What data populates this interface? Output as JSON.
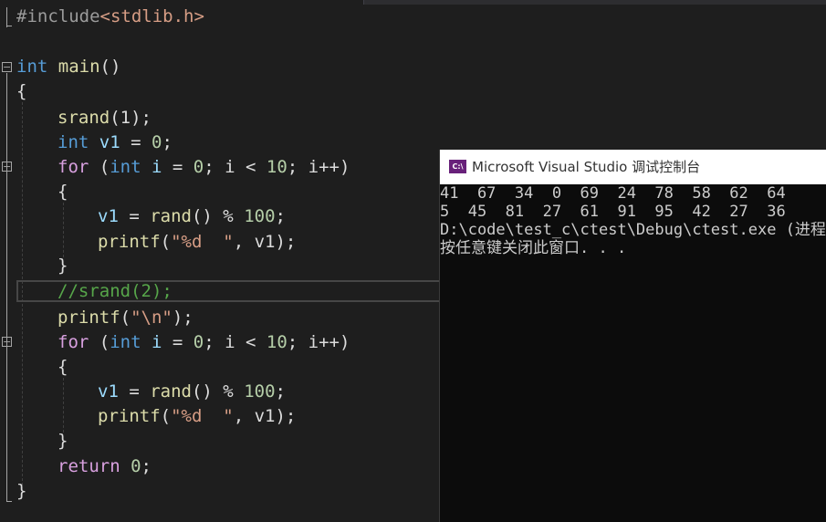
{
  "colors": {
    "editor_bg": "#1e1e1e",
    "keyword": "#569cd6",
    "control_keyword": "#d8a0df",
    "function": "#dcdcaa",
    "number": "#b5cea8",
    "string": "#d69d85",
    "comment": "#57a64a",
    "variable": "#9cdcfe",
    "console_bg": "#0c0c0c",
    "console_text": "#cccccc"
  },
  "code": {
    "include_directive": "#include",
    "include_header": "<stdlib.h>",
    "int_kw": "int",
    "main_fn": "main",
    "parens": "()",
    "open_brace": "{",
    "close_brace": "}",
    "srand_fn": "srand",
    "srand_arg": "(1);",
    "v1_decl_var": "v1",
    "v1_decl_rest": " = ",
    "zero": "0",
    "semicolon": ";",
    "for_kw": "for",
    "loop_open": " (",
    "loop_i": "i",
    "loop_eq": " = ",
    "loop_cond": "; i < ",
    "loop_ten": "10",
    "loop_inc": "; i++)",
    "v1_var": "v1",
    "assign": " = ",
    "rand_fn": "rand",
    "rand_rest": "() % ",
    "hundred": "100",
    "printf_fn": "printf",
    "paren_open": "(",
    "fmt_str": "\"%d  \"",
    "printf_args": ", v1);",
    "comment_line": "//srand(2);",
    "newline_str": "\"\\n\"",
    "paren_close_semi": ");",
    "return_kw": "return",
    "return_val": " 0",
    "fold_symbol": "−"
  },
  "console": {
    "icon_label": "C:\\",
    "title": "Microsoft Visual Studio 调试控制台",
    "lines": [
      "41  67  34  0  69  24  78  58  62  64",
      "5  45  81  27  61  91  95  42  27  36",
      "D:\\code\\test_c\\ctest\\Debug\\ctest.exe (进程",
      "按任意键关闭此窗口. . ."
    ]
  }
}
